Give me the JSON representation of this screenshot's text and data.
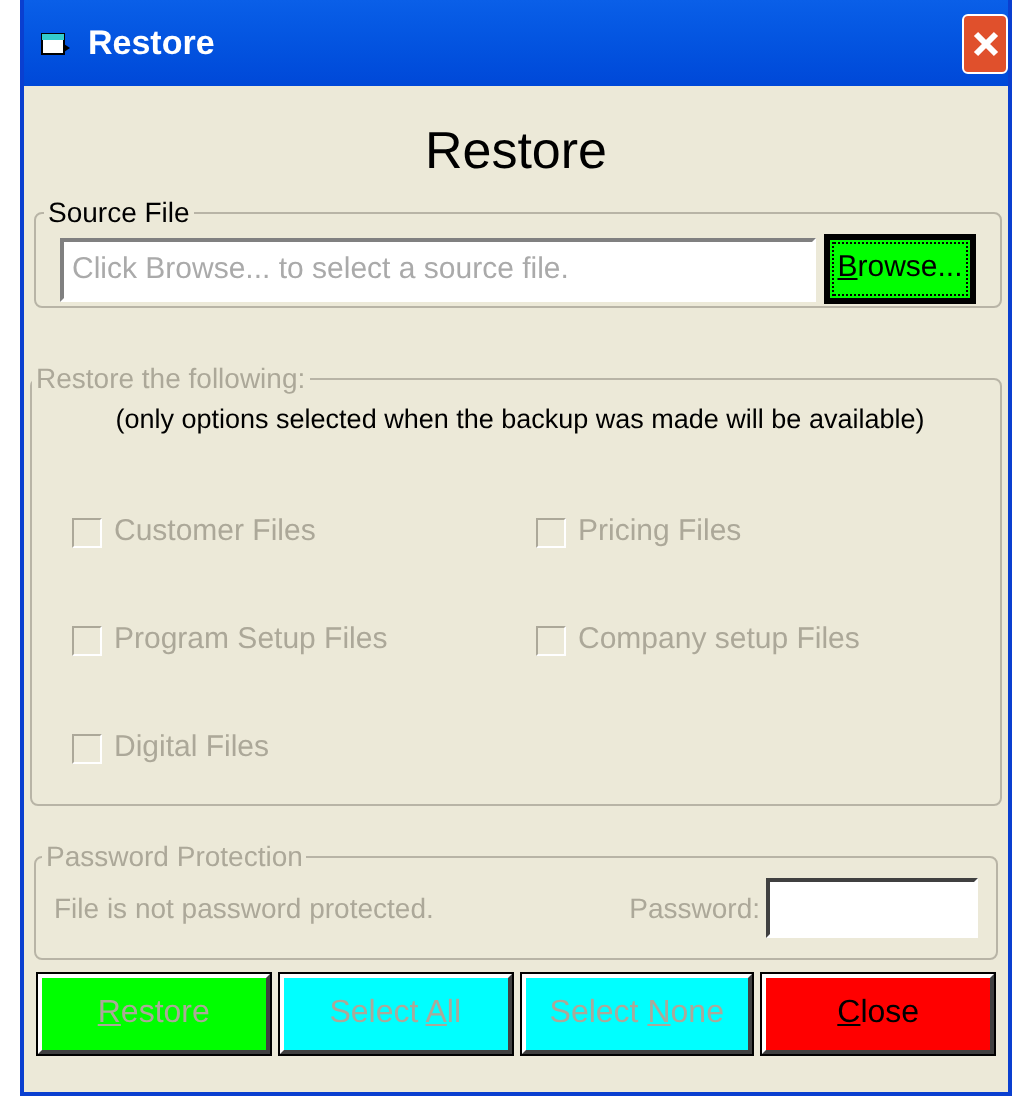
{
  "window": {
    "title": "Restore"
  },
  "heading": "Restore",
  "source_file": {
    "legend": "Source File",
    "placeholder": "Click Browse... to select a source file.",
    "browse_button": {
      "label_parts": [
        {
          "text": "B",
          "underlined": true
        },
        {
          "text": "rowse...",
          "underlined": false
        }
      ],
      "disabled": false,
      "focused": true
    }
  },
  "restore_options": {
    "legend": "Restore the following:",
    "disabled": true,
    "note": "(only options selected when the backup was made will be available)",
    "items": [
      {
        "label": "Customer Files",
        "checked": false,
        "disabled": true
      },
      {
        "label": "Pricing Files",
        "checked": false,
        "disabled": true
      },
      {
        "label": "Program Setup Files",
        "checked": false,
        "disabled": true
      },
      {
        "label": "Company setup Files",
        "checked": false,
        "disabled": true
      },
      {
        "label": "Digital Files",
        "checked": false,
        "disabled": true
      }
    ]
  },
  "password_protection": {
    "legend": "Password Protection",
    "disabled": true,
    "status": "File is not password protected.",
    "password_label": "Password:"
  },
  "buttons": [
    {
      "label_parts": [
        {
          "text": "R",
          "underlined": true
        },
        {
          "text": "estore",
          "underlined": false
        }
      ],
      "color": "#00ff00",
      "disabled": true
    },
    {
      "label_parts": [
        {
          "text": "Select ",
          "underlined": false
        },
        {
          "text": "A",
          "underlined": true
        },
        {
          "text": "ll",
          "underlined": false
        }
      ],
      "color": "#00ffff",
      "disabled": true
    },
    {
      "label_parts": [
        {
          "text": "Select ",
          "underlined": false
        },
        {
          "text": "N",
          "underlined": true
        },
        {
          "text": "one",
          "underlined": false
        }
      ],
      "color": "#00ffff",
      "disabled": true
    },
    {
      "label_parts": [
        {
          "text": "C",
          "underlined": true
        },
        {
          "text": "lose",
          "underlined": false
        }
      ],
      "color": "#ff0000",
      "disabled": false
    }
  ]
}
